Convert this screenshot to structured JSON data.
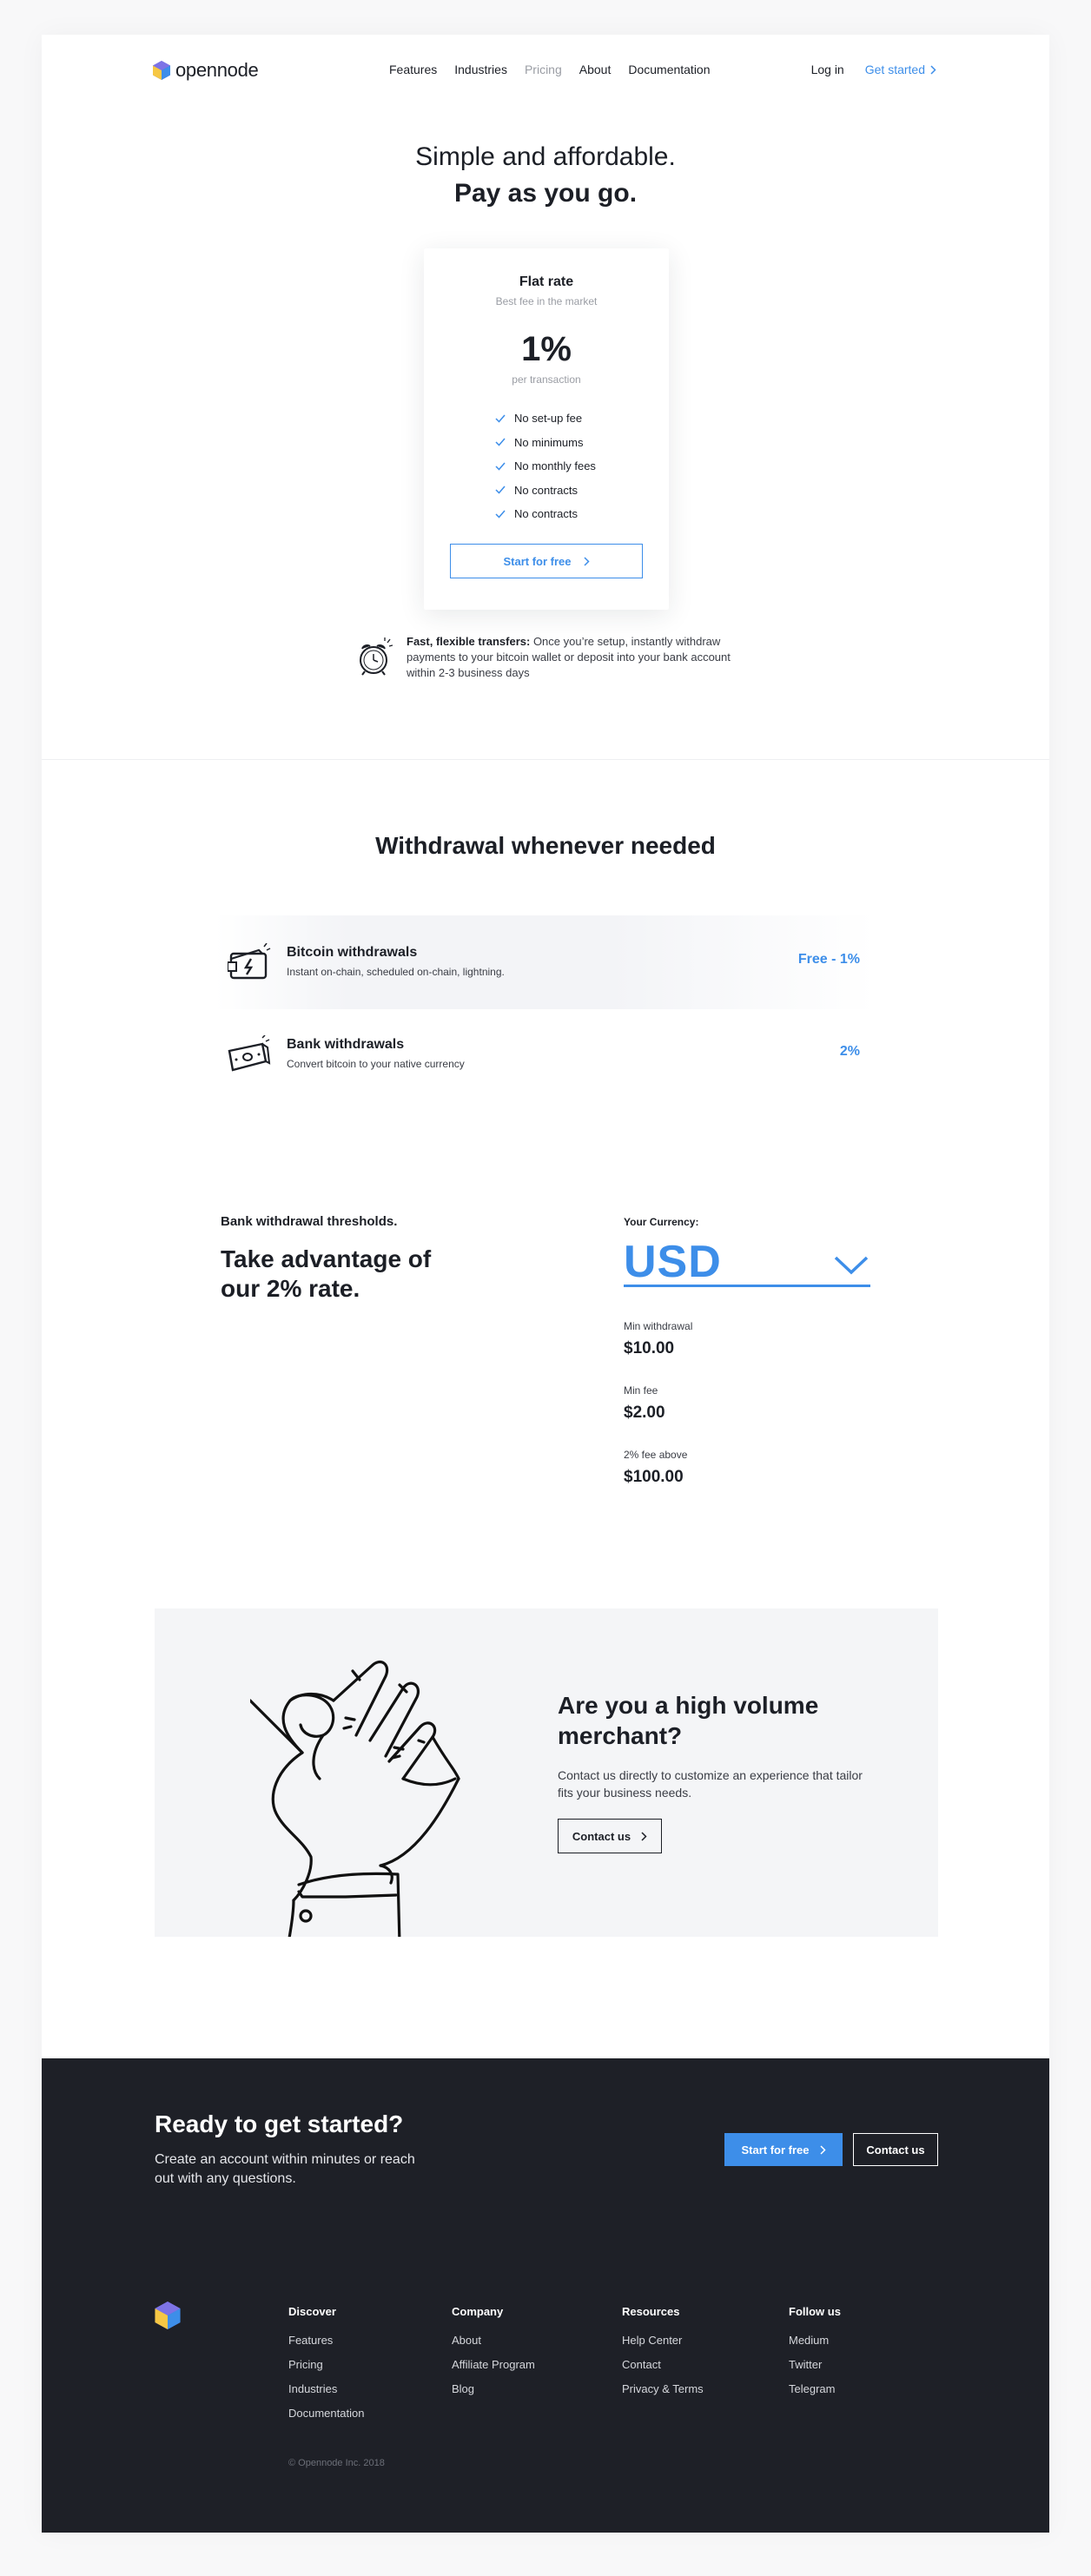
{
  "nav": {
    "brand": "opennode",
    "links": [
      "Features",
      "Industries",
      "Pricing",
      "About",
      "Documentation"
    ],
    "login": "Log in",
    "get_started": "Get started"
  },
  "hero": {
    "line1": "Simple and affordable.",
    "line2": "Pay as you go."
  },
  "rate_card": {
    "title": "Flat rate",
    "subtitle": "Best fee in the market",
    "rate": "1%",
    "rate_caption": "per transaction",
    "features": [
      "No set-up fee",
      "No minimums",
      "No monthly fees",
      "No contracts",
      "No contracts"
    ],
    "cta": "Start for free"
  },
  "transfer": {
    "bold": "Fast, flexible transfers:",
    "text": " Once you’re setup, instantly withdraw payments to your bitcoin wallet or deposit into your bank account within 2-3 business days"
  },
  "withdrawal": {
    "title": "Withdrawal whenever needed",
    "rows": [
      {
        "name": "Bitcoin withdrawals",
        "desc": "Instant on-chain, scheduled on-chain, lightning.",
        "value": "Free - 1%"
      },
      {
        "name": "Bank withdrawals",
        "desc": "Convert bitcoin to your native currency",
        "value": "2%"
      }
    ]
  },
  "thresholds": {
    "kicker": "Bank withdrawal thresholds.",
    "heading": "Take advantage of our 2% rate.",
    "currency_label": "Your Currency:",
    "currency": "USD",
    "items": [
      {
        "label": "Min withdrawal",
        "value": "$10.00"
      },
      {
        "label": "Min fee",
        "value": "$2.00"
      },
      {
        "label": "2% fee above",
        "value": "$100.00"
      }
    ]
  },
  "merchant": {
    "title": "Are you a high volume merchant?",
    "desc": "Contact us directly to customize an experience that tailor fits your business needs.",
    "cta": "Contact us"
  },
  "footer": {
    "title": "Ready to get started?",
    "subtitle": "Create an account within minutes or reach out with any questions.",
    "primary_cta": "Start for free",
    "secondary_cta": "Contact us",
    "columns": [
      {
        "heading": "Discover",
        "links": [
          "Features",
          "Pricing",
          "Industries",
          "Documentation"
        ]
      },
      {
        "heading": "Company",
        "links": [
          "About",
          "Affiliate Program",
          "Blog"
        ]
      },
      {
        "heading": "Resources",
        "links": [
          "Help Center",
          "Contact",
          "Privacy & Terms"
        ]
      },
      {
        "heading": "Follow us",
        "links": [
          "Medium",
          "Twitter",
          "Telegram"
        ]
      }
    ],
    "copyright": "© Opennode Inc. 2018"
  },
  "colors": {
    "accent": "#3d8ee9",
    "text": "#1c1f26",
    "footer_bg": "#1e2027",
    "panel_bg": "#f4f5f7"
  }
}
